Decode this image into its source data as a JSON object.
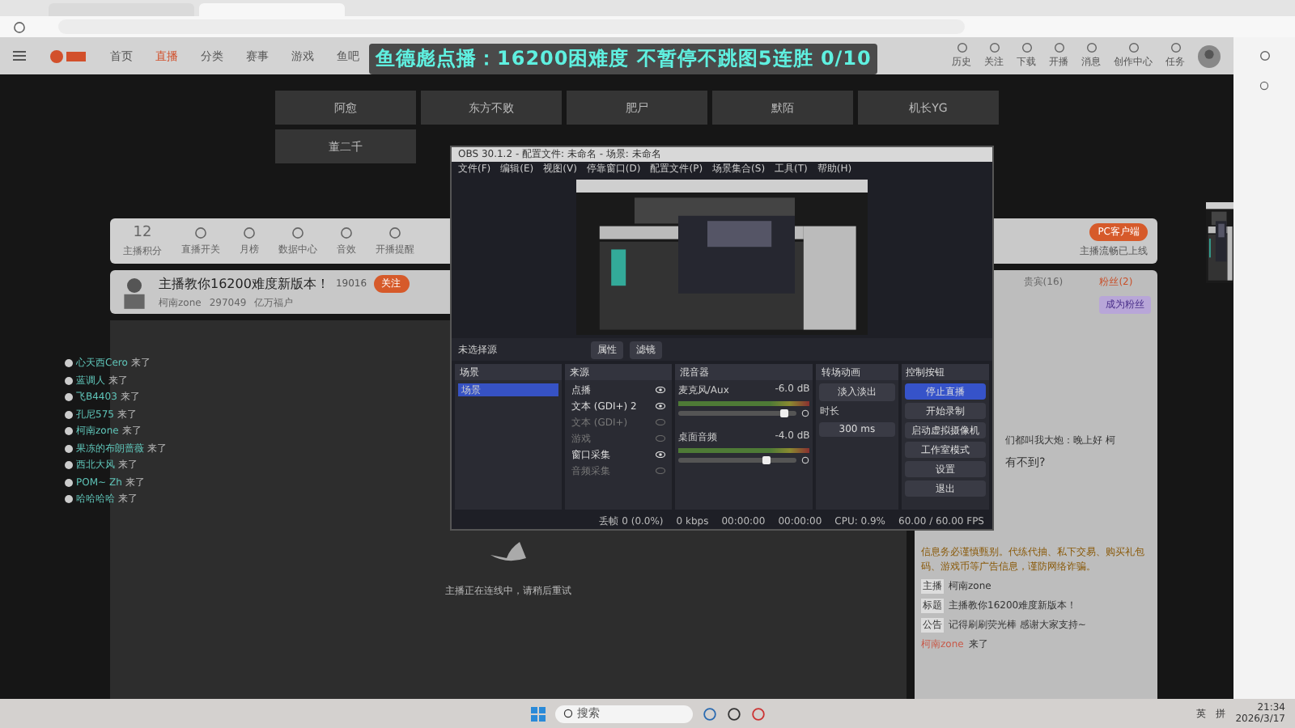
{
  "nav": {
    "links": [
      {
        "label": "首页",
        "selected": false
      },
      {
        "label": "直播",
        "selected": true
      },
      {
        "label": "分类",
        "selected": false
      },
      {
        "label": "赛事",
        "selected": false
      },
      {
        "label": "游戏",
        "selected": false
      },
      {
        "label": "鱼吧",
        "selected": false
      }
    ],
    "actions": [
      "历史",
      "关注",
      "下载",
      "开播",
      "消息",
      "创作中心",
      "任务"
    ]
  },
  "banner": "鱼德彪点播：16200困难度 不暂停不跳图5连胜 0/10",
  "tiles": [
    [
      "阿愈",
      "东方不败",
      "肥尸",
      "默陌",
      "机长YG"
    ],
    [
      "董二千"
    ]
  ],
  "stats": {
    "rank": "12",
    "rank_label": "主播积分",
    "items": [
      "直播开关",
      "月榜",
      "数据中心",
      "音效",
      "开播提醒"
    ]
  },
  "client": {
    "button": "PC客户端",
    "note": "主播流畅已上线"
  },
  "room": {
    "title": "主播教你16200难度新版本！",
    "followers": "19016",
    "follow": "关注",
    "host": "柯南zone",
    "heat": "297049",
    "badge": "亿万福户"
  },
  "joins": [
    {
      "name": "心天西Cero",
      "text": "来了"
    },
    {
      "name": "蓝调人",
      "text": "来了"
    },
    {
      "name": "飞B4403",
      "text": "来了"
    },
    {
      "name": "孔尼575",
      "text": "来了"
    },
    {
      "name": "柯南zone",
      "text": "来了"
    },
    {
      "name": "果冻的布朗蔷薇",
      "text": "来了"
    },
    {
      "name": "西北大风",
      "text": "来了"
    },
    {
      "name": "POM~ Zh",
      "text": "来了"
    },
    {
      "name": "哈哈哈哈",
      "text": "来了"
    }
  ],
  "video": {
    "message": "主播正在连线中，请稍后重试"
  },
  "chat": {
    "tabs": [
      {
        "label": "贵宾(16)",
        "selected": false
      },
      {
        "label": "粉丝(2)",
        "selected": true
      }
    ],
    "fan_button": "成为粉丝",
    "greeting": "们都叫我大炮：晚上好 柯",
    "question": "有不到?",
    "warning": "信息务必谨慎甄别。代练代抽、私下交易、购买礼包码、游戏币等广告信息，谨防网络诈骗。",
    "info": [
      {
        "label": "主播",
        "value": "柯南zone"
      },
      {
        "label": "标题",
        "value": "主播教你16200难度新版本！"
      },
      {
        "label": "公告",
        "value": "记得刷刷荧光棒 感谢大家支持~"
      }
    ],
    "last": {
      "name": "柯南zone",
      "text": "来了"
    }
  },
  "obs": {
    "title": "OBS 30.1.2 - 配置文件: 未命名 - 场景: 未命名",
    "menu": [
      "文件(F)",
      "编辑(E)",
      "视图(V)",
      "停靠窗口(D)",
      "配置文件(P)",
      "场景集合(S)",
      "工具(T)",
      "帮助(H)"
    ],
    "no_source": "未选择源",
    "props": [
      "属性",
      "滤镜"
    ],
    "docks": [
      "场景",
      "来源",
      "混音器",
      "转场动画",
      "控制按钮"
    ],
    "scenes": [
      {
        "name": "场景",
        "selected": true
      }
    ],
    "sources": [
      {
        "name": "点播",
        "visible": true
      },
      {
        "name": "文本 (GDI+) 2",
        "visible": true
      },
      {
        "name": "文本 (GDI+)",
        "visible": false
      },
      {
        "name": "游戏",
        "visible": false
      },
      {
        "name": "窗口采集",
        "visible": true
      },
      {
        "name": "音频采集",
        "visible": false
      }
    ],
    "mixer": [
      {
        "name": "麦克风/Aux",
        "reading": "-6.0 dB",
        "level": 0.9
      },
      {
        "name": "桌面音频",
        "reading": "-4.0 dB",
        "level": 0.75
      }
    ],
    "transition": {
      "type": "淡入淡出",
      "duration_label": "时长",
      "duration": "300 ms"
    },
    "controls": [
      {
        "label": "停止直播",
        "selected": true
      },
      {
        "label": "开始录制",
        "selected": false
      },
      {
        "label": "启动虚拟摄像机",
        "selected": false
      },
      {
        "label": "工作室模式",
        "selected": false
      },
      {
        "label": "设置",
        "selected": false
      },
      {
        "label": "退出",
        "selected": false
      }
    ],
    "status": [
      "丢帧 0 (0.0%)",
      "0 kbps",
      "00:00:00",
      "00:00:00",
      "CPU: 0.9%",
      "60.00 / 60.00 FPS"
    ]
  },
  "taskbar": {
    "search": "搜索",
    "lang": "英",
    "ime": "拼",
    "time": "21:34",
    "date": "2026/3/17"
  }
}
